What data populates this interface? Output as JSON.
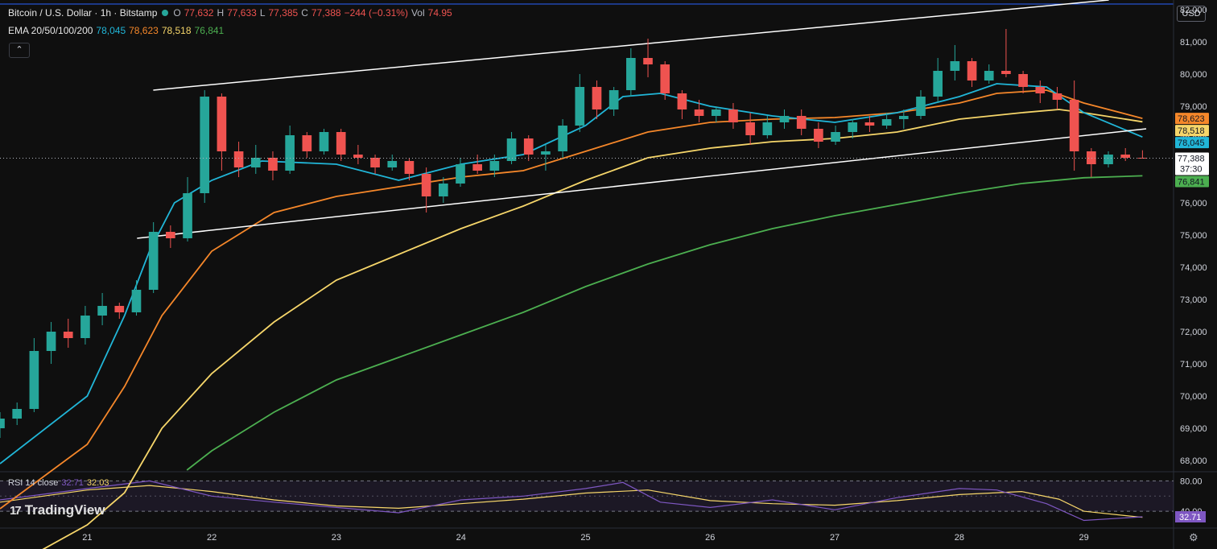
{
  "header": {
    "symbol": "Bitcoin / U.S. Dollar · 1h · Bitstamp",
    "o_label": "O",
    "o_value": "77,632",
    "h_label": "H",
    "h_value": "77,633",
    "l_label": "L",
    "l_value": "77,385",
    "c_label": "C",
    "c_value": "77,388",
    "change": "−244 (−0.31%)",
    "vol_label": "Vol",
    "vol_value": "74.95",
    "ema_label": "EMA 20/50/100/200",
    "ema20": "78,045",
    "ema50": "78,623",
    "ema100": "78,518",
    "ema200": "76,841"
  },
  "currency": "USD",
  "collapse_glyph": "⌃",
  "rsi_header": {
    "label": "RSI 14 close",
    "value1": "32.71",
    "value2": "32.03"
  },
  "brand": {
    "mark": "17",
    "name": "TradingView"
  },
  "colors": {
    "up": "#26a69a",
    "down": "#ef5350",
    "ema20": "#21b6d8",
    "ema50": "#f5872a",
    "ema100": "#f6d66a",
    "ema200": "#4caf50",
    "rsi": "#7e57c2",
    "rsi_ma": "#f6d66a"
  },
  "chart_data": {
    "type": "candlestick",
    "symbol": "BTCUSD",
    "interval": "1h",
    "price_axis": {
      "range": [
        67700,
        82300
      ],
      "ticks": [
        68000,
        69000,
        70000,
        71000,
        72000,
        73000,
        74000,
        75000,
        76000,
        77000,
        78000,
        79000,
        80000,
        81000,
        82000
      ]
    },
    "price_tick_labels": [
      "68,000",
      "69,000",
      "70,000",
      "71,000",
      "72,000",
      "73,000",
      "74,000",
      "75,000",
      "76,000",
      "77,000",
      "78,000",
      "79,000",
      "80,000",
      "81,000",
      "82,000"
    ],
    "x_axis": {
      "day_range": [
        20.3,
        29.7
      ],
      "ticks": [
        21,
        22,
        23,
        24,
        25,
        26,
        27,
        28,
        29
      ],
      "labels": [
        "21",
        "22",
        "23",
        "24",
        "25",
        "26",
        "27",
        "28",
        "29"
      ]
    },
    "candles_ohlc": [
      [
        69000,
        69500,
        68700,
        69300
      ],
      [
        69300,
        69800,
        69100,
        69600
      ],
      [
        69600,
        71800,
        69500,
        71400
      ],
      [
        71400,
        72300,
        71000,
        72000
      ],
      [
        72000,
        72400,
        71500,
        71800
      ],
      [
        71800,
        72800,
        71600,
        72500
      ],
      [
        72500,
        73200,
        72200,
        72800
      ],
      [
        72800,
        72900,
        72400,
        72600
      ],
      [
        72600,
        73600,
        72500,
        73300
      ],
      [
        73300,
        75400,
        73200,
        75100
      ],
      [
        75100,
        75300,
        74600,
        74900
      ],
      [
        74900,
        76800,
        74800,
        76300
      ],
      [
        76300,
        79500,
        76000,
        79300
      ],
      [
        79300,
        79400,
        77000,
        77600
      ],
      [
        77600,
        77900,
        76800,
        77100
      ],
      [
        77100,
        77800,
        76900,
        77400
      ],
      [
        77400,
        77600,
        76700,
        77000
      ],
      [
        77000,
        78400,
        76900,
        78100
      ],
      [
        78100,
        78200,
        77400,
        77600
      ],
      [
        77600,
        78300,
        77500,
        78200
      ],
      [
        78200,
        78300,
        77300,
        77500
      ],
      [
        77500,
        77800,
        77200,
        77400
      ],
      [
        77400,
        77500,
        76900,
        77100
      ],
      [
        77100,
        77500,
        77000,
        77300
      ],
      [
        77300,
        77400,
        76700,
        76900
      ],
      [
        76900,
        77100,
        75700,
        76200
      ],
      [
        76200,
        76800,
        76000,
        76600
      ],
      [
        76600,
        77400,
        76500,
        77200
      ],
      [
        77200,
        77500,
        76900,
        77000
      ],
      [
        77000,
        77500,
        76800,
        77300
      ],
      [
        77300,
        78200,
        77200,
        78000
      ],
      [
        78000,
        78100,
        77300,
        77500
      ],
      [
        77500,
        77800,
        77000,
        77600
      ],
      [
        77600,
        78600,
        77400,
        78400
      ],
      [
        78400,
        80000,
        78200,
        79600
      ],
      [
        79600,
        79800,
        78600,
        78900
      ],
      [
        78900,
        79600,
        78700,
        79500
      ],
      [
        79500,
        80800,
        79300,
        80500
      ],
      [
        80500,
        81100,
        79900,
        80300
      ],
      [
        80300,
        80400,
        79200,
        79400
      ],
      [
        79400,
        79500,
        78600,
        78900
      ],
      [
        78900,
        79200,
        78500,
        78700
      ],
      [
        78700,
        79000,
        78500,
        78900
      ],
      [
        78900,
        79100,
        78300,
        78500
      ],
      [
        78500,
        78800,
        77800,
        78100
      ],
      [
        78100,
        78700,
        78000,
        78500
      ],
      [
        78500,
        78900,
        78300,
        78700
      ],
      [
        78700,
        78900,
        78100,
        78300
      ],
      [
        78300,
        78500,
        77700,
        77900
      ],
      [
        77900,
        78400,
        77800,
        78200
      ],
      [
        78200,
        78600,
        78000,
        78500
      ],
      [
        78500,
        78700,
        78200,
        78400
      ],
      [
        78400,
        78800,
        78300,
        78600
      ],
      [
        78600,
        78900,
        78300,
        78700
      ],
      [
        78700,
        79500,
        78600,
        79300
      ],
      [
        79300,
        80500,
        79100,
        80100
      ],
      [
        80100,
        80900,
        79800,
        80400
      ],
      [
        80400,
        80500,
        79600,
        79800
      ],
      [
        79800,
        80300,
        79700,
        80100
      ],
      [
        80100,
        81400,
        79900,
        80000
      ],
      [
        80000,
        80100,
        79400,
        79600
      ],
      [
        79600,
        79800,
        79100,
        79400
      ],
      [
        79400,
        79600,
        78900,
        79200
      ],
      [
        79200,
        79800,
        77000,
        77600
      ],
      [
        77600,
        77700,
        76800,
        77200
      ],
      [
        77200,
        77600,
        77100,
        77500
      ],
      [
        77500,
        77700,
        77300,
        77400
      ],
      [
        77400,
        77633,
        77385,
        77388
      ]
    ],
    "ema20": [
      [
        20.3,
        67900
      ],
      [
        21.0,
        70000
      ],
      [
        21.3,
        72500
      ],
      [
        21.5,
        74500
      ],
      [
        21.7,
        76000
      ],
      [
        22.0,
        76700
      ],
      [
        22.4,
        77300
      ],
      [
        23.0,
        77200
      ],
      [
        23.5,
        76700
      ],
      [
        24.0,
        77200
      ],
      [
        24.5,
        77500
      ],
      [
        25.0,
        78400
      ],
      [
        25.3,
        79300
      ],
      [
        25.6,
        79400
      ],
      [
        26.0,
        79000
      ],
      [
        26.5,
        78700
      ],
      [
        27.0,
        78500
      ],
      [
        27.5,
        78800
      ],
      [
        28.0,
        79300
      ],
      [
        28.3,
        79700
      ],
      [
        28.7,
        79600
      ],
      [
        29.0,
        78800
      ],
      [
        29.47,
        78045
      ]
    ],
    "ema50": [
      [
        20.3,
        66500
      ],
      [
        21.0,
        68500
      ],
      [
        21.3,
        70300
      ],
      [
        21.6,
        72500
      ],
      [
        22.0,
        74500
      ],
      [
        22.5,
        75700
      ],
      [
        23.0,
        76200
      ],
      [
        23.5,
        76500
      ],
      [
        24.0,
        76800
      ],
      [
        24.5,
        77000
      ],
      [
        25.0,
        77600
      ],
      [
        25.5,
        78200
      ],
      [
        26.0,
        78500
      ],
      [
        26.5,
        78600
      ],
      [
        27.0,
        78650
      ],
      [
        27.5,
        78800
      ],
      [
        28.0,
        79100
      ],
      [
        28.3,
        79400
      ],
      [
        28.7,
        79500
      ],
      [
        29.0,
        79100
      ],
      [
        29.47,
        78623
      ]
    ],
    "ema100": [
      [
        20.3,
        64500
      ],
      [
        21.0,
        66000
      ],
      [
        21.3,
        67000
      ],
      [
        21.6,
        69000
      ],
      [
        22.0,
        70700
      ],
      [
        22.5,
        72300
      ],
      [
        23.0,
        73600
      ],
      [
        23.5,
        74400
      ],
      [
        24.0,
        75200
      ],
      [
        24.5,
        75900
      ],
      [
        25.0,
        76700
      ],
      [
        25.5,
        77400
      ],
      [
        26.0,
        77700
      ],
      [
        26.5,
        77900
      ],
      [
        27.0,
        78000
      ],
      [
        27.5,
        78200
      ],
      [
        28.0,
        78600
      ],
      [
        28.5,
        78800
      ],
      [
        28.8,
        78900
      ],
      [
        29.0,
        78800
      ],
      [
        29.47,
        78518
      ]
    ],
    "ema200": [
      [
        21.8,
        67700
      ],
      [
        22.0,
        68300
      ],
      [
        22.5,
        69500
      ],
      [
        23.0,
        70500
      ],
      [
        23.5,
        71200
      ],
      [
        24.0,
        71900
      ],
      [
        24.5,
        72600
      ],
      [
        25.0,
        73400
      ],
      [
        25.5,
        74100
      ],
      [
        26.0,
        74700
      ],
      [
        26.5,
        75200
      ],
      [
        27.0,
        75600
      ],
      [
        27.5,
        75950
      ],
      [
        28.0,
        76300
      ],
      [
        28.5,
        76600
      ],
      [
        29.0,
        76780
      ],
      [
        29.47,
        76841
      ]
    ],
    "channel_upper": [
      [
        21.53,
        79500
      ],
      [
        29.2,
        82300
      ]
    ],
    "channel_lower": [
      [
        21.4,
        74900
      ],
      [
        29.5,
        78300
      ]
    ],
    "last_price": 77388,
    "countdown": "37:30",
    "price_badges": [
      {
        "label": "78,623",
        "series": "ema50"
      },
      {
        "label": "78,518",
        "series": "ema100"
      },
      {
        "label": "78,045",
        "series": "ema20"
      },
      {
        "label": "77,388",
        "series": "close"
      },
      {
        "label": "76,841",
        "series": "ema200"
      }
    ],
    "rsi": {
      "range": [
        20,
        90
      ],
      "ticks": [
        80,
        60,
        40
      ],
      "tick_labels": [
        "80.00",
        "40.00"
      ],
      "current_label": "32.71",
      "series": [
        [
          20.3,
          55
        ],
        [
          21.0,
          70
        ],
        [
          21.5,
          80
        ],
        [
          22.0,
          60
        ],
        [
          22.5,
          52
        ],
        [
          23.0,
          45
        ],
        [
          23.5,
          38
        ],
        [
          24.0,
          55
        ],
        [
          24.5,
          60
        ],
        [
          25.0,
          70
        ],
        [
          25.3,
          78
        ],
        [
          25.6,
          52
        ],
        [
          26.0,
          45
        ],
        [
          26.5,
          55
        ],
        [
          27.0,
          42
        ],
        [
          27.5,
          58
        ],
        [
          28.0,
          70
        ],
        [
          28.3,
          68
        ],
        [
          28.7,
          50
        ],
        [
          29.0,
          28
        ],
        [
          29.47,
          32.71
        ]
      ],
      "ma": [
        [
          20.3,
          52
        ],
        [
          21.0,
          68
        ],
        [
          21.5,
          74
        ],
        [
          22.0,
          66
        ],
        [
          22.5,
          55
        ],
        [
          23.0,
          47
        ],
        [
          23.5,
          44
        ],
        [
          24.0,
          50
        ],
        [
          24.5,
          56
        ],
        [
          25.0,
          64
        ],
        [
          25.5,
          68
        ],
        [
          26.0,
          54
        ],
        [
          26.5,
          50
        ],
        [
          27.0,
          48
        ],
        [
          27.5,
          54
        ],
        [
          28.0,
          62
        ],
        [
          28.5,
          66
        ],
        [
          28.8,
          56
        ],
        [
          29.0,
          40
        ],
        [
          29.47,
          32.03
        ]
      ]
    }
  }
}
